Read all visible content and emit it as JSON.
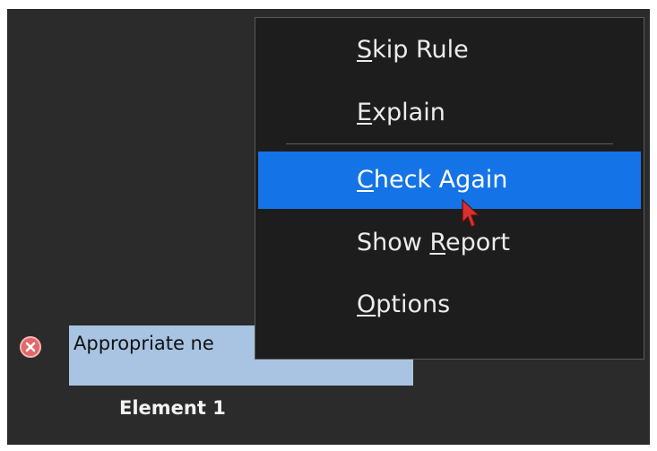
{
  "issue": {
    "label": "Appropriate ne",
    "status_icon": "error-x-icon",
    "status_color": "#e0686a"
  },
  "element": {
    "label": "Element 1"
  },
  "context_menu": {
    "items": [
      {
        "before": "",
        "mnemonic": "S",
        "after": "kip Rule"
      },
      {
        "before": "",
        "mnemonic": "E",
        "after": "xplain"
      },
      {
        "before": "",
        "mnemonic": "C",
        "after": "heck Again"
      },
      {
        "before": "Show ",
        "mnemonic": "R",
        "after": "eport"
      },
      {
        "before": "",
        "mnemonic": "O",
        "after": "ptions"
      }
    ],
    "highlighted_item": "Check Again",
    "highlight_color": "#1473e6"
  },
  "cursor": {
    "icon": "arrow-pointer-icon",
    "color": "#d93030"
  }
}
